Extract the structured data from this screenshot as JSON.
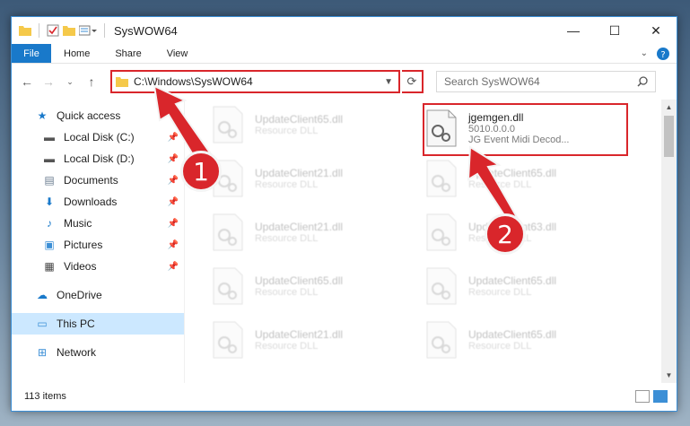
{
  "window": {
    "title": "SysWOW64",
    "controls": {
      "minimize": "—",
      "maximize": "☐",
      "close": "✕"
    }
  },
  "ribbon": {
    "tabs": [
      "File",
      "Home",
      "Share",
      "View"
    ]
  },
  "address_bar": {
    "path": "C:\\Windows\\SysWOW64"
  },
  "search": {
    "placeholder": "Search SysWOW64"
  },
  "sidebar": {
    "items": [
      {
        "label": "Quick access",
        "icon": "star-icon"
      },
      {
        "label": "Local Disk (C:)",
        "icon": "drive-icon"
      },
      {
        "label": "Local Disk (D:)",
        "icon": "drive-icon"
      },
      {
        "label": "Documents",
        "icon": "documents-icon"
      },
      {
        "label": "Downloads",
        "icon": "download-icon"
      },
      {
        "label": "Music",
        "icon": "music-icon"
      },
      {
        "label": "Pictures",
        "icon": "pictures-icon"
      },
      {
        "label": "Videos",
        "icon": "videos-icon"
      },
      {
        "label": "OneDrive",
        "icon": "cloud-icon"
      },
      {
        "label": "This PC",
        "icon": "computer-icon"
      },
      {
        "label": "Network",
        "icon": "network-icon"
      }
    ]
  },
  "files": {
    "left_column": [
      {
        "name": "UpdateClient65.dll",
        "type": "Resource DLL"
      },
      {
        "name": "UpdateClient21.dll",
        "type": "Resource DLL"
      },
      {
        "name": "UpdateClient21.dll",
        "type": "Resource DLL"
      },
      {
        "name": "UpdateClient65.dll",
        "type": "Resource DLL"
      },
      {
        "name": "UpdateClient21.dll",
        "type": "Resource DLL"
      }
    ],
    "highlighted": {
      "name": "jgemgen.dll",
      "version": "5010.0.0.0",
      "description": "JG Event Midi Decod..."
    },
    "right_column": [
      {
        "name": "UpdateClient65.dll",
        "type": "Resource DLL"
      },
      {
        "name": "UpdateClient63.dll",
        "type": "Resource DLL"
      },
      {
        "name": "UpdateClient65.dll",
        "type": "Resource DLL"
      },
      {
        "name": "UpdateClient65.dll",
        "type": "Resource DLL"
      }
    ]
  },
  "status_bar": {
    "item_count": "113 items"
  },
  "annotations": {
    "step1": "1",
    "step2": "2",
    "color": "#d9262b"
  }
}
